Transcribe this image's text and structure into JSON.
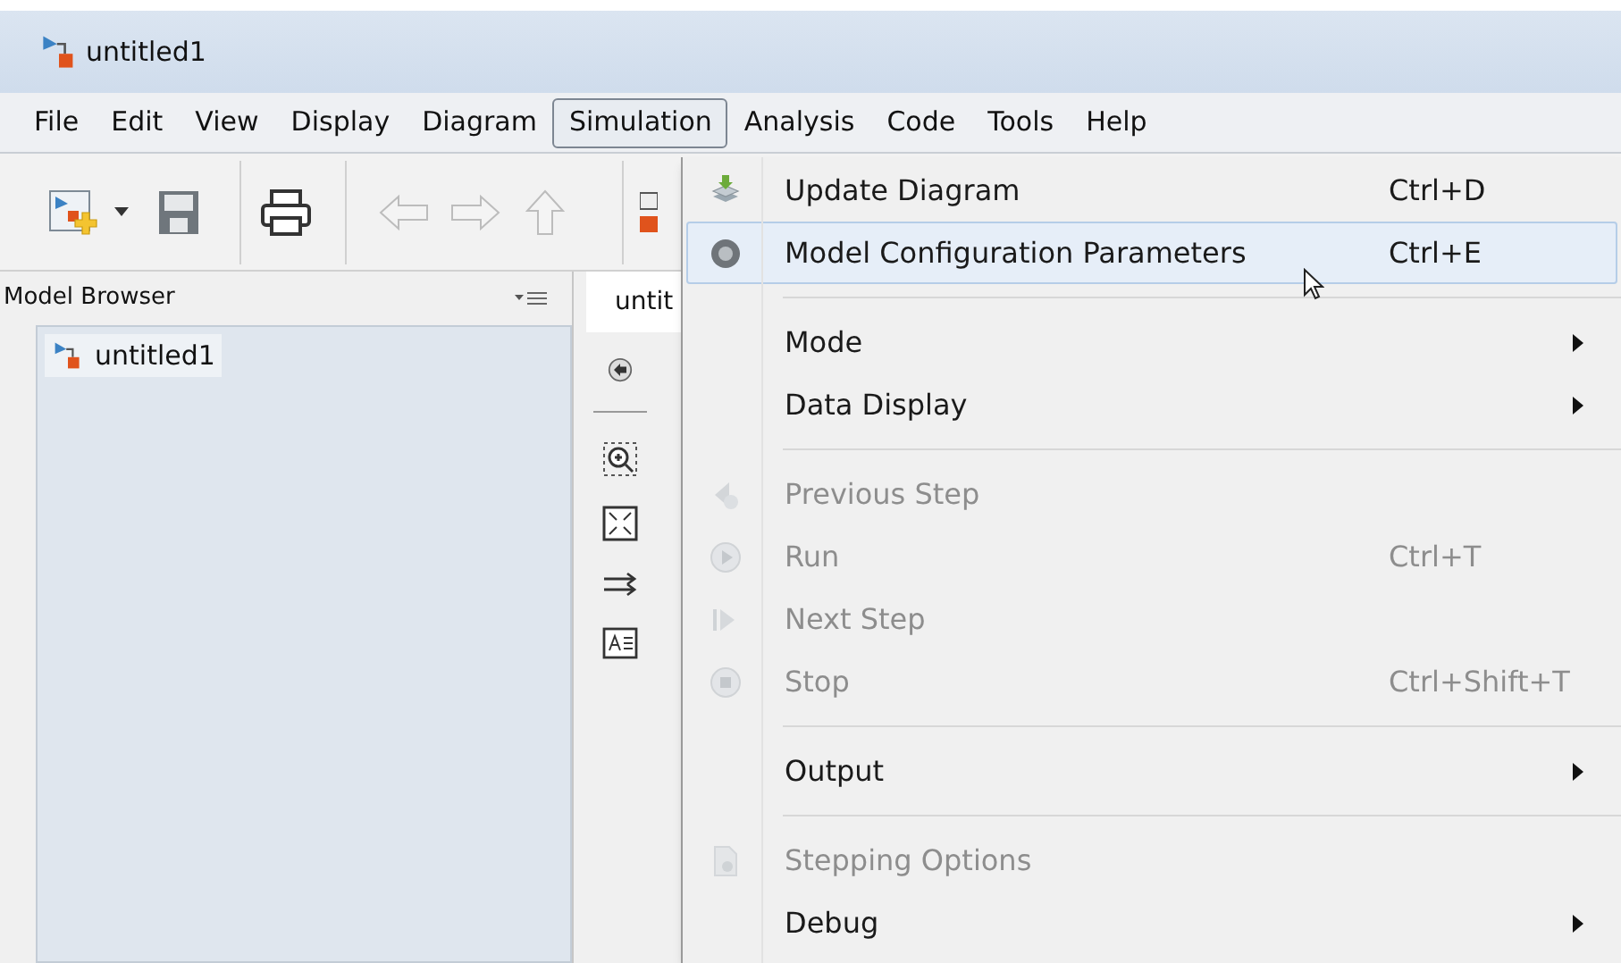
{
  "window": {
    "title": "untitled1"
  },
  "menu_bar": [
    {
      "label": "File",
      "selected": false
    },
    {
      "label": "Edit",
      "selected": false
    },
    {
      "label": "View",
      "selected": false
    },
    {
      "label": "Display",
      "selected": false
    },
    {
      "label": "Diagram",
      "selected": false
    },
    {
      "label": "Simulation",
      "selected": true
    },
    {
      "label": "Analysis",
      "selected": false
    },
    {
      "label": "Code",
      "selected": false
    },
    {
      "label": "Tools",
      "selected": false
    },
    {
      "label": "Help",
      "selected": false
    }
  ],
  "model_browser": {
    "title": "Model Browser",
    "items": [
      {
        "label": "untitled1",
        "selected": true
      }
    ]
  },
  "editor_tab": {
    "label": "untit"
  },
  "dropdown": [
    {
      "kind": "item",
      "label": "Update Diagram",
      "shortcut": "Ctrl+D",
      "disabled": false,
      "selected": false,
      "submenu": false
    },
    {
      "kind": "item",
      "label": "Model Configuration Parameters",
      "shortcut": "Ctrl+E",
      "disabled": false,
      "selected": true,
      "submenu": false
    },
    {
      "kind": "separator"
    },
    {
      "kind": "item",
      "label": "Mode",
      "disabled": false,
      "selected": false,
      "submenu": true
    },
    {
      "kind": "item",
      "label": "Data Display",
      "disabled": false,
      "selected": false,
      "submenu": true
    },
    {
      "kind": "separator"
    },
    {
      "kind": "item",
      "label": "Previous Step",
      "disabled": true,
      "selected": false,
      "submenu": false
    },
    {
      "kind": "item",
      "label": "Run",
      "shortcut": "Ctrl+T",
      "disabled": true,
      "selected": false,
      "submenu": false
    },
    {
      "kind": "item",
      "label": "Next Step",
      "disabled": true,
      "selected": false,
      "submenu": false
    },
    {
      "kind": "item",
      "label": "Stop",
      "shortcut": "Ctrl+Shift+T",
      "disabled": true,
      "selected": false,
      "submenu": false
    },
    {
      "kind": "separator"
    },
    {
      "kind": "item",
      "label": "Output",
      "disabled": false,
      "selected": false,
      "submenu": true
    },
    {
      "kind": "separator"
    },
    {
      "kind": "item",
      "label": "Stepping Options",
      "disabled": true,
      "selected": false,
      "submenu": false
    },
    {
      "kind": "item",
      "label": "Debug",
      "disabled": false,
      "selected": false,
      "submenu": true
    }
  ]
}
